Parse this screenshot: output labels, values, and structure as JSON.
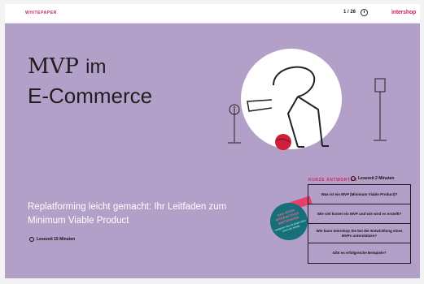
{
  "header": {
    "section_label": "WHITEPAPER",
    "pager": "1 / 26",
    "brand": "intershop"
  },
  "hero": {
    "title_word_1": "MVP",
    "title_word_2": "im",
    "title_line_2": "E-Commerce",
    "subtitle": "Replatforming leicht gemacht: Ihr Leitfaden zum Minimum Viable Product",
    "read_time": "Lesezeit 15 Minuten"
  },
  "quick_answers": {
    "heading": "KURZE ANTWORTEN",
    "read_time": "Lesezeit 2 Minuten",
    "items": [
      "Was ist ein MVP (Minimum Viable Product)?",
      "Wie viel kostet ein MVP und wie wird es erstellt?",
      "Wie kann Intershop Sie bei der Entwicklung eines MVPs unterstützen?",
      "Gibt es erfolgreiche Beispiele?"
    ]
  },
  "badge": {
    "top": "DAS ISTEIN INTERAKTIVES WHITEPAPER",
    "bottom": "navigieren Sie mit einem Klick durch die Inhalte"
  },
  "colors": {
    "background": "#b3a0c8",
    "accent": "#d2235a",
    "badge": "#15707a"
  },
  "icons": [
    "clock-icon",
    "intershop-logo"
  ]
}
